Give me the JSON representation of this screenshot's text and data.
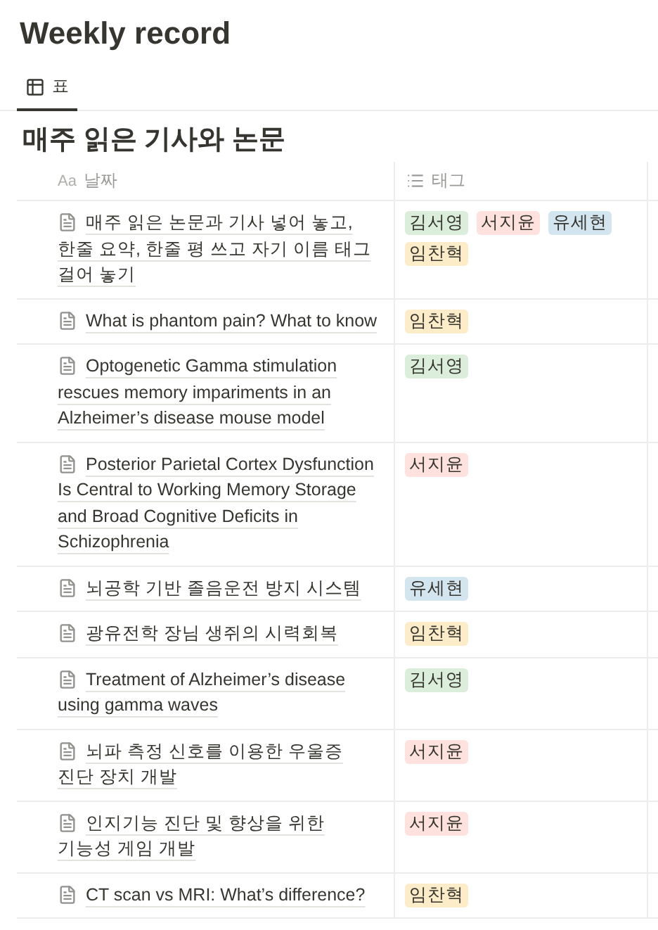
{
  "page": {
    "title": "Weekly record"
  },
  "views": [
    {
      "label": "표",
      "selected": true
    }
  ],
  "database": {
    "title": "매주 읽은 기사와 논문",
    "columns": [
      {
        "kind": "title",
        "type_mark": "Aa",
        "label": "날짜"
      },
      {
        "kind": "tags",
        "label": "태그"
      }
    ],
    "rows": [
      {
        "title": "매주 읽은 논문과 기사 넣어 놓고, 한줄 요약, 한줄 평 쓰고 자기 이름 태그 걸어 놓기",
        "tags": [
          {
            "label": "김서영",
            "color": "#dbeddb"
          },
          {
            "label": "서지윤",
            "color": "#ffe2dd"
          },
          {
            "label": "유세현",
            "color": "#d3e5ef"
          },
          {
            "label": "임찬혁",
            "color": "#fdecc8"
          }
        ]
      },
      {
        "title": "What is phantom pain? What to know",
        "tags": [
          {
            "label": "임찬혁",
            "color": "#fdecc8"
          }
        ]
      },
      {
        "title": "Optogenetic Gamma stimulation rescues memory impariments in an Alzheimer’s disease mouse model",
        "tags": [
          {
            "label": "김서영",
            "color": "#dbeddb"
          }
        ]
      },
      {
        "title": "Posterior Parietal Cortex Dysfunction Is Central to Working Memory Storage and Broad Cognitive Deficits in Schizophrenia",
        "tags": [
          {
            "label": "서지윤",
            "color": "#ffe2dd"
          }
        ]
      },
      {
        "title": "뇌공학 기반 졸음운전 방지 시스템",
        "tags": [
          {
            "label": "유세현",
            "color": "#d3e5ef"
          }
        ]
      },
      {
        "title": "광유전학 장님 생쥐의 시력회복",
        "tags": [
          {
            "label": "임찬혁",
            "color": "#fdecc8"
          }
        ]
      },
      {
        "title": "Treatment of Alzheimer’s disease using gamma waves",
        "tags": [
          {
            "label": "김서영",
            "color": "#dbeddb"
          }
        ]
      },
      {
        "title": "뇌파 측정 신호를 이용한 우울증 진단 장치 개발",
        "tags": [
          {
            "label": "서지윤",
            "color": "#ffe2dd"
          }
        ]
      },
      {
        "title": "인지기능 진단 및 향상을 위한 기능성 게임 개발",
        "tags": [
          {
            "label": "서지윤",
            "color": "#ffe2dd"
          }
        ]
      },
      {
        "title": "CT scan vs MRI: What’s difference?",
        "tags": [
          {
            "label": "임찬혁",
            "color": "#fdecc8"
          }
        ]
      }
    ]
  }
}
